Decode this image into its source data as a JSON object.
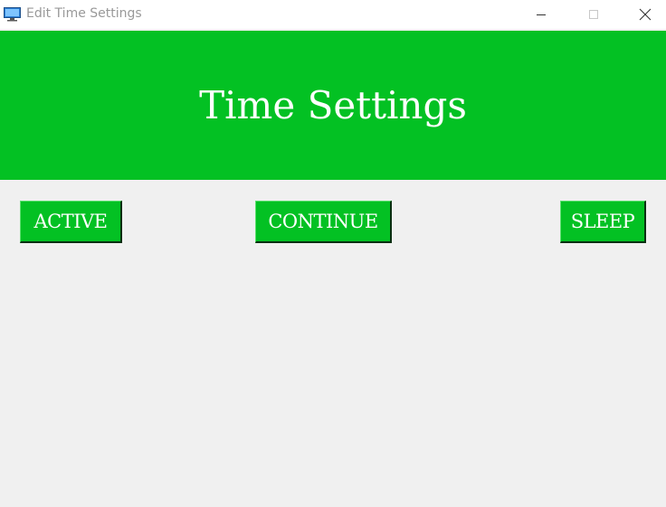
{
  "window": {
    "title": "Edit Time Settings",
    "app_icon": "monitor-icon",
    "controls": [
      "minimize-icon",
      "maximize-icon",
      "close-icon"
    ]
  },
  "header": {
    "title": "Time Settings",
    "background_color": "#03c123",
    "text_color": "#ffffff"
  },
  "buttons": {
    "active_label": "ACTIVE",
    "continue_label": "CONTINUE",
    "sleep_label": "SLEEP",
    "background_color": "#03c123"
  },
  "colors": {
    "accent": "#03c123",
    "body_background": "#f0f0f0"
  }
}
